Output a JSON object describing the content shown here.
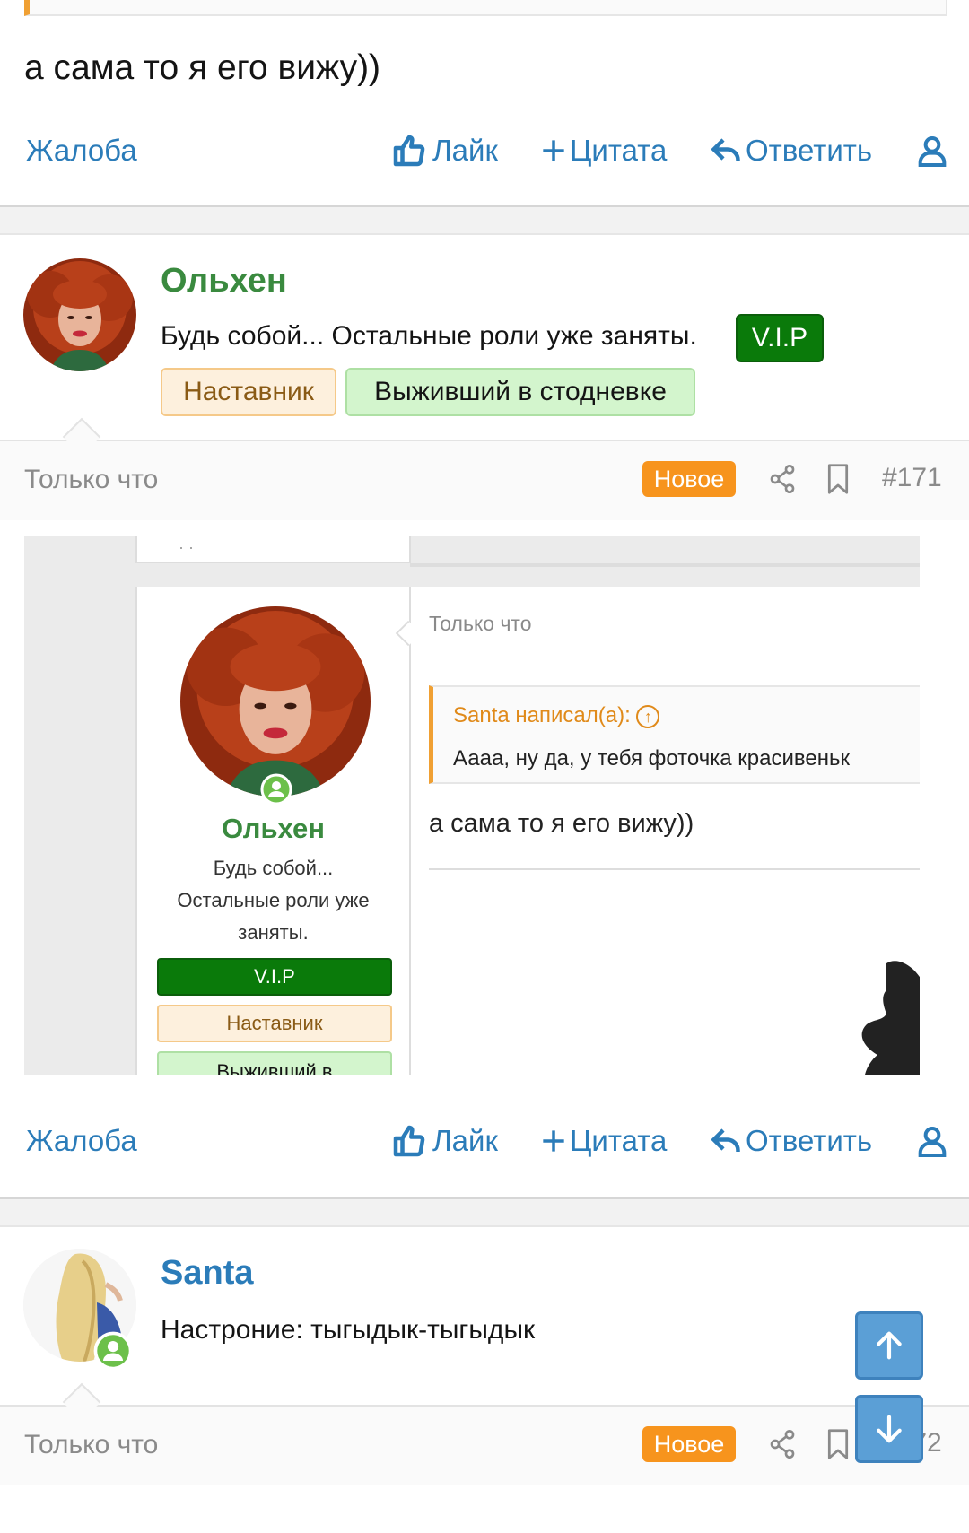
{
  "top_message": {
    "text": "а сама то я его вижу))"
  },
  "actions": {
    "report": "Жалоба",
    "like": "Лайк",
    "quote": "Цитата",
    "reply": "Ответить"
  },
  "post1": {
    "author": "Ольхен",
    "title": "Будь собой... Остальные роли уже заняты.",
    "badges": {
      "vip": "V.I.P",
      "mentor": "Наставник",
      "survivor": "Выживший в стодневке"
    },
    "time": "Только что",
    "new_label": "Новое",
    "number": "#171",
    "screenshot": {
      "time": "Только что",
      "quote_author": "Santa написал(а):",
      "quote_text": "Аааа, ну да, у тебя фоточка красивеньк",
      "message": "а сама то я его вижу))",
      "author": "Ольхен",
      "title_l1": "Будь собой...",
      "title_l2": "Остальные роли уже",
      "title_l3": "заняты.",
      "vip": "V.I.P",
      "mentor": "Наставник",
      "survivor": "Выживший в"
    }
  },
  "post2": {
    "author": "Santa",
    "title": "Настроние: тыгыдык-тыгыдык",
    "time": "Только что",
    "new_label": "Новое",
    "number": "#172"
  },
  "colors": {
    "link": "#2b7cb9",
    "author_green": "#3a8a3f",
    "author_blue": "#2b7cb9",
    "new_badge": "#f7941d",
    "vip": "#0a7a0a"
  }
}
